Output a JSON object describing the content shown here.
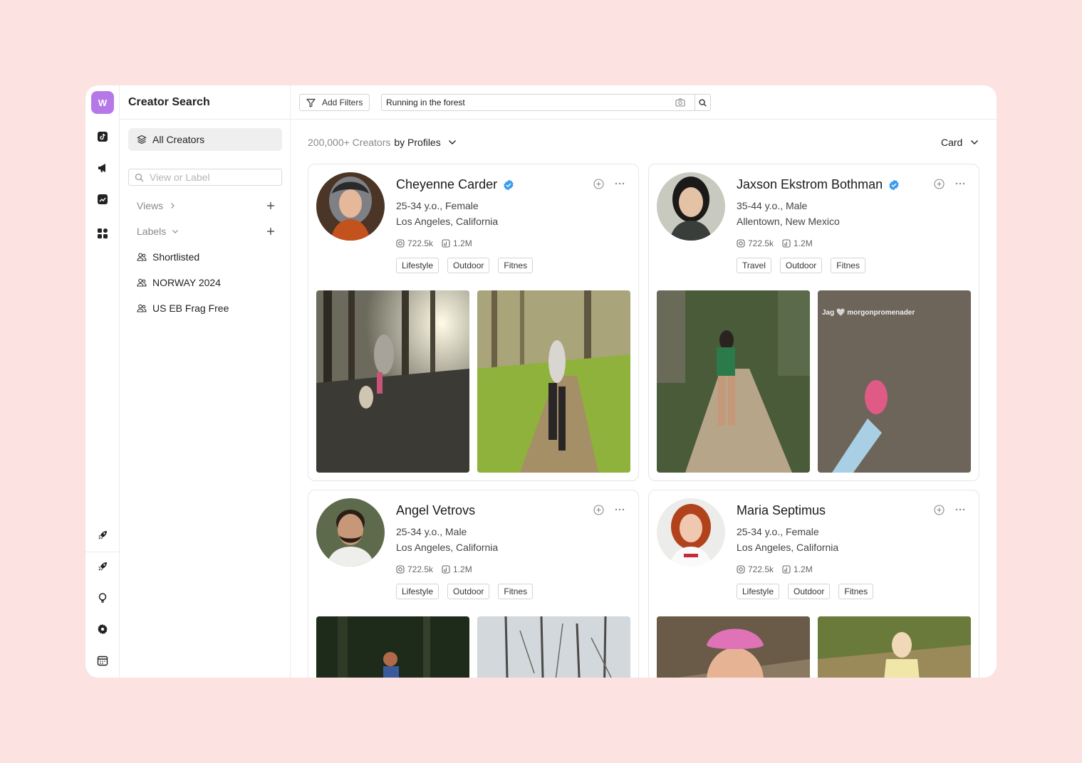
{
  "app": {
    "logo_letter": "W",
    "title": "Creator Search"
  },
  "sidebar": {
    "all_creators": "All Creators",
    "search_placeholder": "View or Label",
    "views_label": "Views",
    "labels_label": "Labels",
    "labels": [
      "Shortlisted",
      "NORWAY 2024",
      "US EB Frag Free"
    ]
  },
  "topbar": {
    "add_filters": "Add Filters",
    "query": "Running in the forest"
  },
  "results": {
    "count": "200,000+ Creators",
    "by": "by Profiles",
    "view_mode": "Card"
  },
  "icons": {
    "rail_top": [
      "tiktok-icon",
      "megaphone-icon",
      "analytics-icon",
      "apps-icon"
    ],
    "rail_bottom": [
      "rocket-icon",
      "rocket-icon",
      "lightbulb-icon",
      "gear-icon",
      "calendar-icon"
    ]
  },
  "colors": {
    "accent": "#b678e6",
    "background": "#fde2e2",
    "verified": "#3b9bf0"
  },
  "creators": [
    {
      "name": "Cheyenne Carder",
      "verified": true,
      "demo": "25-34 y.o., Female",
      "location": "Los Angeles, California",
      "instagram": "722.5k",
      "tiktok": "1.2M",
      "tags": [
        "Lifestyle",
        "Outdoor",
        "Fitnes"
      ],
      "photo_captions": [
        "",
        ""
      ]
    },
    {
      "name": "Jaxson Ekstrom Bothman",
      "verified": true,
      "demo": "35-44 y.o., Male",
      "location": "Allentown, New Mexico",
      "instagram": "722.5k",
      "tiktok": "1.2M",
      "tags": [
        "Travel",
        "Outdoor",
        "Fitnes"
      ],
      "photo_captions": [
        "",
        "Jag 🤍 morgonpromenader"
      ]
    },
    {
      "name": "Angel Vetrovs",
      "verified": false,
      "demo": "25-34 y.o., Male",
      "location": "Los Angeles, California",
      "instagram": "722.5k",
      "tiktok": "1.2M",
      "tags": [
        "Lifestyle",
        "Outdoor",
        "Fitnes"
      ],
      "photo_captions": [
        "",
        ""
      ]
    },
    {
      "name": "Maria Septimus",
      "verified": false,
      "demo": "25-34 y.o., Female",
      "location": "Los Angeles, California",
      "instagram": "722.5k",
      "tiktok": "1.2M",
      "tags": [
        "Lifestyle",
        "Outdoor",
        "Fitnes"
      ],
      "photo_captions": [
        "",
        ""
      ]
    }
  ]
}
